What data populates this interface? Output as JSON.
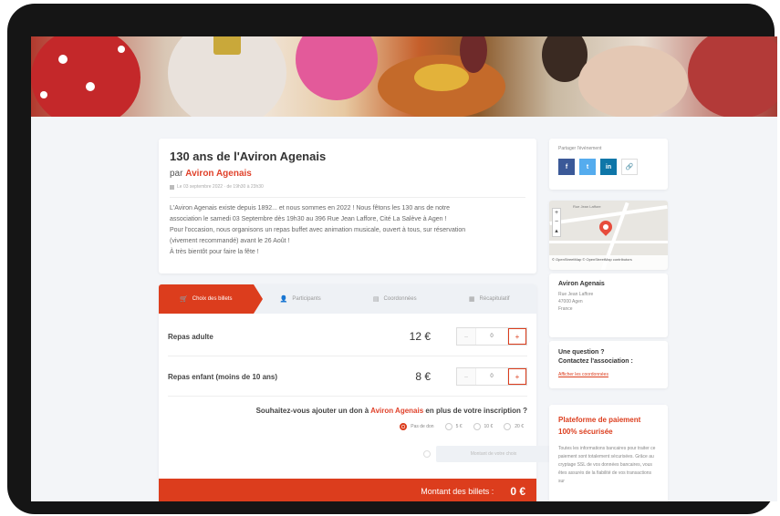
{
  "event": {
    "title": "130 ans de l'Aviron Agenais",
    "by_prefix": "par",
    "organizer": "Aviron Agenais",
    "date": "Le 03 septembre 2022 · de 19h30 à 23h30",
    "description": [
      "L'Aviron Agenais existe depuis 1892... et nous sommes en 2022 ! Nous fêtons les 130 ans de notre",
      "association le samedi 03 Septembre dès 19h30 au 396 Rue Jean Laffore, Cité La Salève à Agen !",
      "Pour l'occasion, nous organisons un repas buffet avec animation musicale, ouvert à tous, sur réservation",
      "(vivement recommandé) avant le 26 Août !",
      "À très bientôt pour faire la fête !"
    ]
  },
  "steps": [
    {
      "label": "Choix des billets",
      "icon": "cart-icon",
      "glyph": "🛒",
      "active": true
    },
    {
      "label": "Participants",
      "icon": "person-icon",
      "glyph": "👤",
      "active": false
    },
    {
      "label": "Coordonnées",
      "icon": "card-icon",
      "glyph": "▤",
      "active": false
    },
    {
      "label": "Récapitulatif",
      "icon": "summary-icon",
      "glyph": "▦",
      "active": false
    }
  ],
  "tickets": [
    {
      "name": "Repas adulte",
      "price": "12 €",
      "qty": "0"
    },
    {
      "name": "Repas enfant (moins de 10 ans)",
      "price": "8 €",
      "qty": "0"
    }
  ],
  "donation": {
    "question_prefix": "Souhaitez-vous ajouter un don à",
    "organizer": "Aviron Agenais",
    "question_suffix": "en plus de votre inscription ?",
    "options": [
      "Pas de don",
      "5 €",
      "10 €",
      "20 €"
    ],
    "selected": "Pas de don",
    "other_placeholder": "Montant de votre choix"
  },
  "total": {
    "label": "Montant des billets :",
    "amount": "0 €"
  },
  "share": {
    "title": "Partager l'événement",
    "buttons": [
      "f",
      "t",
      "in",
      "🔗"
    ]
  },
  "map": {
    "zoom_in": "+",
    "zoom_out": "−",
    "compass": "▴",
    "street": "Rue Jean Laffore",
    "attribution": "© OpenStreetMap © OpenStreetMap contributors"
  },
  "organizer_card": {
    "name": "Aviron Agenais",
    "address": [
      "Rue Jean Laffore",
      "47000 Agen",
      "France"
    ]
  },
  "question": {
    "title_line1": "Une question ?",
    "title_line2": "Contactez l'association :",
    "link": "Afficher les coordonnées"
  },
  "payment": {
    "title_line1": "Plateforme de paiement",
    "title_line2": "100% sécurisée",
    "text": "Toutes les informations bancaires pour traiter ce paiement sont totalement sécurisées. Grâce au cryptage SSL de vos données bancaires, vous êtes assurés de la fiabilité de vos transactions sur"
  },
  "colors": {
    "accent": "#dc3d1d",
    "background": "#f3f5f8",
    "device": "#151515"
  }
}
